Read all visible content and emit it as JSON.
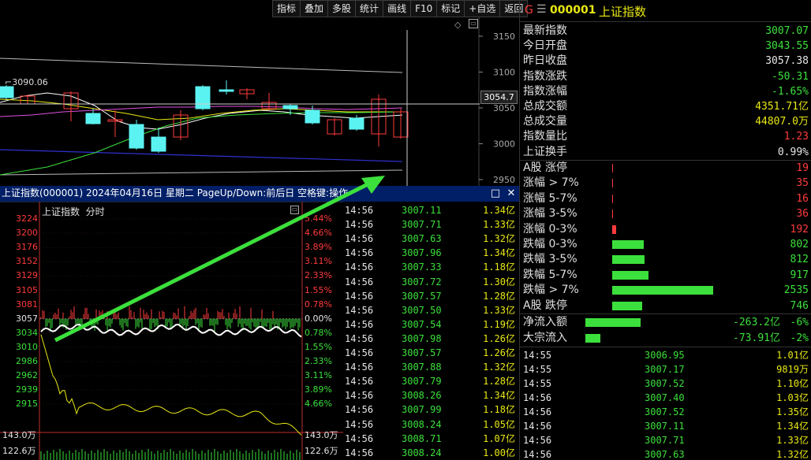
{
  "toolbar": [
    "指标",
    "叠加",
    "多股",
    "统计",
    "画线",
    "F10",
    "标记",
    "+自选",
    "返回"
  ],
  "kline": {
    "price_axis": [
      "3150",
      "3100",
      "3050",
      "3000",
      "2950"
    ],
    "crosshair_price": "3054.7",
    "ma_label": "3090.06",
    "colors": {
      "up": "#ff3b3b",
      "down": "#5bf2f2",
      "ma5": "#ffffff",
      "ma10": "#e8e814",
      "ma20": "#e050e0",
      "ma60": "#3ce03c",
      "channel": "#3030d0"
    }
  },
  "info_bar": {
    "text": "上证指数(000001) 2024年04月16日 星期二 PageUp/Down:前后日 空格键:操作",
    "btn_restore": "□",
    "btn_close": "✕"
  },
  "intraday": {
    "title": "上证指数",
    "subtitle": "分时",
    "left_axis": [
      "3224",
      "3200",
      "3176",
      "3152",
      "3129",
      "3105",
      "3081",
      "3057",
      "3034",
      "3010",
      "2986",
      "2962",
      "2939",
      "2915"
    ],
    "right_axis": [
      "5.44%",
      "4.66%",
      "3.89%",
      "3.11%",
      "2.33%",
      "1.55%",
      "0.78%",
      "0.00%",
      "0.78%",
      "1.55%",
      "2.33%",
      "3.11%",
      "3.89%",
      "4.66%"
    ],
    "vol_left": [
      "143.0万",
      "122.6万"
    ],
    "vol_right": [
      "143.0万",
      "122.6万"
    ],
    "colors": {
      "price": "#ffffff",
      "avg": "#e8e814",
      "up": "#ff3b3b",
      "down": "#3ce03c"
    }
  },
  "ticks": [
    {
      "t": "14:56",
      "p": "3007.11",
      "v": "1.34亿"
    },
    {
      "t": "14:56",
      "p": "3007.71",
      "v": "1.33亿"
    },
    {
      "t": "14:56",
      "p": "3007.63",
      "v": "1.32亿"
    },
    {
      "t": "14:56",
      "p": "3007.96",
      "v": "1.34亿"
    },
    {
      "t": "14:56",
      "p": "3007.33",
      "v": "1.18亿"
    },
    {
      "t": "14:56",
      "p": "3007.72",
      "v": "1.30亿"
    },
    {
      "t": "14:56",
      "p": "3007.57",
      "v": "1.28亿"
    },
    {
      "t": "14:56",
      "p": "3007.50",
      "v": "1.33亿"
    },
    {
      "t": "14:56",
      "p": "3007.54",
      "v": "1.19亿"
    },
    {
      "t": "14:56",
      "p": "3007.98",
      "v": "1.26亿"
    },
    {
      "t": "14:56",
      "p": "3007.57",
      "v": "1.26亿"
    },
    {
      "t": "14:56",
      "p": "3007.88",
      "v": "1.32亿"
    },
    {
      "t": "14:56",
      "p": "3007.79",
      "v": "1.28亿"
    },
    {
      "t": "14:56",
      "p": "3008.26",
      "v": "1.34亿"
    },
    {
      "t": "14:56",
      "p": "3007.99",
      "v": "1.18亿"
    },
    {
      "t": "14:56",
      "p": "3008.24",
      "v": "1.05亿"
    },
    {
      "t": "14:56",
      "p": "3008.71",
      "v": "1.07亿"
    },
    {
      "t": "14:56",
      "p": "3008.24",
      "v": "1.00亿"
    }
  ],
  "right": {
    "header": {
      "badge": "G",
      "menu": "☰",
      "code": "000001",
      "name": "上证指数"
    },
    "stats": [
      {
        "label": "最新指数",
        "value": "3007.07",
        "color": "green"
      },
      {
        "label": "今日开盘",
        "value": "3043.55",
        "color": "green"
      },
      {
        "label": "昨日收盘",
        "value": "3057.38",
        "color": "white"
      },
      {
        "label": "指数涨跌",
        "value": "-50.31",
        "color": "green"
      },
      {
        "label": "指数涨幅",
        "value": "-1.65%",
        "color": "green"
      },
      {
        "label": "总成交额",
        "value": "4351.71亿",
        "color": "yellow"
      },
      {
        "label": "总成交量",
        "value": "44807.0万",
        "color": "yellow"
      },
      {
        "label": "指数量比",
        "value": "1.23",
        "color": "red"
      },
      {
        "label": "上证换手",
        "value": "0.99%",
        "color": "white"
      }
    ],
    "breadth": [
      {
        "label": "A股 涨停",
        "value": "19",
        "color": "red",
        "ratio": 0.004
      },
      {
        "label": "涨幅 > 7%",
        "value": "35",
        "color": "red",
        "ratio": 0.004
      },
      {
        "label": "涨幅 5-7%",
        "value": "16",
        "color": "red",
        "ratio": 0.004
      },
      {
        "label": "涨幅 3-5%",
        "value": "36",
        "color": "red",
        "ratio": 0.004
      },
      {
        "label": "涨幅 0-3%",
        "value": "192",
        "color": "red",
        "ratio": 0.04
      },
      {
        "label": "跌幅 0-3%",
        "value": "802",
        "color": "green",
        "ratio": 0.316
      },
      {
        "label": "跌幅 3-5%",
        "value": "812",
        "color": "green",
        "ratio": 0.32
      },
      {
        "label": "跌幅 5-7%",
        "value": "917",
        "color": "green",
        "ratio": 0.362
      },
      {
        "label": "跌幅 > 7%",
        "value": "2535",
        "color": "green",
        "ratio": 1.0
      },
      {
        "label": "A股 跌停",
        "value": "746",
        "color": "green",
        "ratio": 0.294
      }
    ],
    "flows": [
      {
        "label": "净流入额",
        "value": "-263.2亿",
        "pct": "-6%",
        "ratio": 1.0
      },
      {
        "label": "大宗流入",
        "value": "-73.91亿",
        "pct": "-2%",
        "ratio": 0.27
      }
    ],
    "ticks": [
      {
        "t": "14:55",
        "p": "3006.95",
        "v": "1.01亿"
      },
      {
        "t": "14:55",
        "p": "3007.17",
        "v": "9819万"
      },
      {
        "t": "14:55",
        "p": "3007.52",
        "v": "1.10亿"
      },
      {
        "t": "14:56",
        "p": "3007.40",
        "v": "1.03亿"
      },
      {
        "t": "14:56",
        "p": "3007.52",
        "v": "1.35亿"
      },
      {
        "t": "14:56",
        "p": "3007.11",
        "v": "1.34亿"
      },
      {
        "t": "14:56",
        "p": "3007.71",
        "v": "1.33亿"
      },
      {
        "t": "14:56",
        "p": "3007.63",
        "v": "1.32亿"
      }
    ]
  }
}
